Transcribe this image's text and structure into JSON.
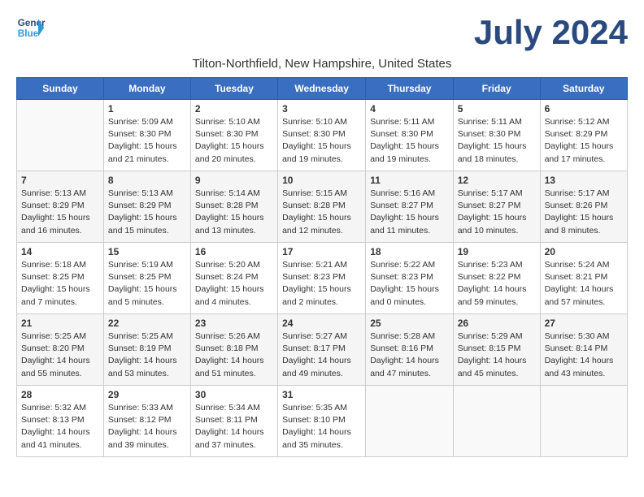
{
  "header": {
    "logo_line1": "General",
    "logo_line2": "Blue",
    "month": "July 2024",
    "subtitle": "Tilton-Northfield, New Hampshire, United States"
  },
  "weekdays": [
    "Sunday",
    "Monday",
    "Tuesday",
    "Wednesday",
    "Thursday",
    "Friday",
    "Saturday"
  ],
  "weeks": [
    [
      {
        "day": "",
        "info": ""
      },
      {
        "day": "1",
        "info": "Sunrise: 5:09 AM\nSunset: 8:30 PM\nDaylight: 15 hours\nand 21 minutes."
      },
      {
        "day": "2",
        "info": "Sunrise: 5:10 AM\nSunset: 8:30 PM\nDaylight: 15 hours\nand 20 minutes."
      },
      {
        "day": "3",
        "info": "Sunrise: 5:10 AM\nSunset: 8:30 PM\nDaylight: 15 hours\nand 19 minutes."
      },
      {
        "day": "4",
        "info": "Sunrise: 5:11 AM\nSunset: 8:30 PM\nDaylight: 15 hours\nand 19 minutes."
      },
      {
        "day": "5",
        "info": "Sunrise: 5:11 AM\nSunset: 8:30 PM\nDaylight: 15 hours\nand 18 minutes."
      },
      {
        "day": "6",
        "info": "Sunrise: 5:12 AM\nSunset: 8:29 PM\nDaylight: 15 hours\nand 17 minutes."
      }
    ],
    [
      {
        "day": "7",
        "info": "Sunrise: 5:13 AM\nSunset: 8:29 PM\nDaylight: 15 hours\nand 16 minutes."
      },
      {
        "day": "8",
        "info": "Sunrise: 5:13 AM\nSunset: 8:29 PM\nDaylight: 15 hours\nand 15 minutes."
      },
      {
        "day": "9",
        "info": "Sunrise: 5:14 AM\nSunset: 8:28 PM\nDaylight: 15 hours\nand 13 minutes."
      },
      {
        "day": "10",
        "info": "Sunrise: 5:15 AM\nSunset: 8:28 PM\nDaylight: 15 hours\nand 12 minutes."
      },
      {
        "day": "11",
        "info": "Sunrise: 5:16 AM\nSunset: 8:27 PM\nDaylight: 15 hours\nand 11 minutes."
      },
      {
        "day": "12",
        "info": "Sunrise: 5:17 AM\nSunset: 8:27 PM\nDaylight: 15 hours\nand 10 minutes."
      },
      {
        "day": "13",
        "info": "Sunrise: 5:17 AM\nSunset: 8:26 PM\nDaylight: 15 hours\nand 8 minutes."
      }
    ],
    [
      {
        "day": "14",
        "info": "Sunrise: 5:18 AM\nSunset: 8:25 PM\nDaylight: 15 hours\nand 7 minutes."
      },
      {
        "day": "15",
        "info": "Sunrise: 5:19 AM\nSunset: 8:25 PM\nDaylight: 15 hours\nand 5 minutes."
      },
      {
        "day": "16",
        "info": "Sunrise: 5:20 AM\nSunset: 8:24 PM\nDaylight: 15 hours\nand 4 minutes."
      },
      {
        "day": "17",
        "info": "Sunrise: 5:21 AM\nSunset: 8:23 PM\nDaylight: 15 hours\nand 2 minutes."
      },
      {
        "day": "18",
        "info": "Sunrise: 5:22 AM\nSunset: 8:23 PM\nDaylight: 15 hours\nand 0 minutes."
      },
      {
        "day": "19",
        "info": "Sunrise: 5:23 AM\nSunset: 8:22 PM\nDaylight: 14 hours\nand 59 minutes."
      },
      {
        "day": "20",
        "info": "Sunrise: 5:24 AM\nSunset: 8:21 PM\nDaylight: 14 hours\nand 57 minutes."
      }
    ],
    [
      {
        "day": "21",
        "info": "Sunrise: 5:25 AM\nSunset: 8:20 PM\nDaylight: 14 hours\nand 55 minutes."
      },
      {
        "day": "22",
        "info": "Sunrise: 5:25 AM\nSunset: 8:19 PM\nDaylight: 14 hours\nand 53 minutes."
      },
      {
        "day": "23",
        "info": "Sunrise: 5:26 AM\nSunset: 8:18 PM\nDaylight: 14 hours\nand 51 minutes."
      },
      {
        "day": "24",
        "info": "Sunrise: 5:27 AM\nSunset: 8:17 PM\nDaylight: 14 hours\nand 49 minutes."
      },
      {
        "day": "25",
        "info": "Sunrise: 5:28 AM\nSunset: 8:16 PM\nDaylight: 14 hours\nand 47 minutes."
      },
      {
        "day": "26",
        "info": "Sunrise: 5:29 AM\nSunset: 8:15 PM\nDaylight: 14 hours\nand 45 minutes."
      },
      {
        "day": "27",
        "info": "Sunrise: 5:30 AM\nSunset: 8:14 PM\nDaylight: 14 hours\nand 43 minutes."
      }
    ],
    [
      {
        "day": "28",
        "info": "Sunrise: 5:32 AM\nSunset: 8:13 PM\nDaylight: 14 hours\nand 41 minutes."
      },
      {
        "day": "29",
        "info": "Sunrise: 5:33 AM\nSunset: 8:12 PM\nDaylight: 14 hours\nand 39 minutes."
      },
      {
        "day": "30",
        "info": "Sunrise: 5:34 AM\nSunset: 8:11 PM\nDaylight: 14 hours\nand 37 minutes."
      },
      {
        "day": "31",
        "info": "Sunrise: 5:35 AM\nSunset: 8:10 PM\nDaylight: 14 hours\nand 35 minutes."
      },
      {
        "day": "",
        "info": ""
      },
      {
        "day": "",
        "info": ""
      },
      {
        "day": "",
        "info": ""
      }
    ]
  ]
}
